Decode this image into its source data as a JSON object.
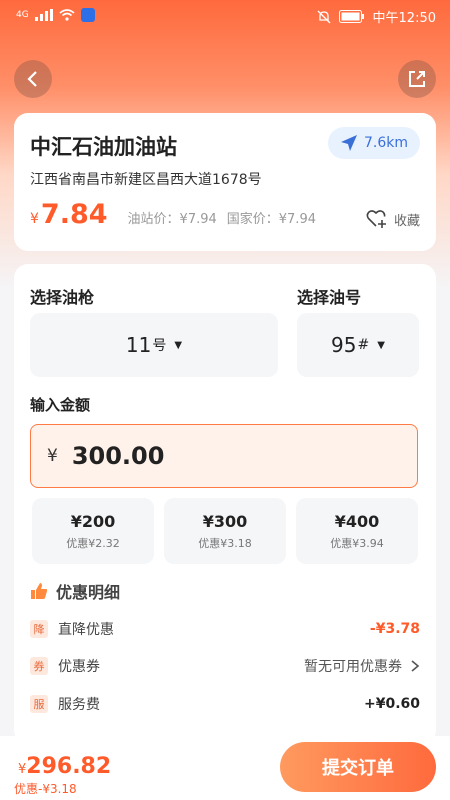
{
  "status": {
    "signal": "4G",
    "time": "中午12:50"
  },
  "station": {
    "name": "中汇石油加油站",
    "distance": "7.6km",
    "address": "江西省南昌市新建区昌西大道1678号",
    "price_symbol": "¥",
    "price": "7.84",
    "station_price": "油站价：¥7.94",
    "national_price": "国家价：¥7.94",
    "fav_label": "收藏"
  },
  "order": {
    "gun_label": "选择油枪",
    "gun_value": "11",
    "gun_unit": "号",
    "fuel_label": "选择油号",
    "fuel_value": "95",
    "fuel_unit": "#",
    "amount_label": "输入金额",
    "amount_symbol": "¥",
    "amount_value": "300.00",
    "quick_amounts": [
      {
        "amount": "¥200",
        "discount": "优惠¥2.32"
      },
      {
        "amount": "¥300",
        "discount": "优惠¥3.18"
      },
      {
        "amount": "¥400",
        "discount": "优惠¥3.94"
      }
    ],
    "discount_title": "优惠明细",
    "discount_rows": [
      {
        "badge": "降",
        "label": "直降优惠",
        "value": "-¥3.78",
        "color": "#ff5a2a"
      },
      {
        "badge": "券",
        "label": "优惠券",
        "value": "暂无可用优惠券",
        "color": "#555555"
      },
      {
        "badge": "服",
        "label": "服务费",
        "value": "+¥0.60",
        "color": "#222222"
      }
    ]
  },
  "footer": {
    "total_symbol": "¥",
    "total": "296.82",
    "total_discount": "优惠-¥3.18",
    "submit": "提交订单"
  },
  "colors": {
    "accent": "#ff5a2a",
    "blue": "#3b6fd8"
  }
}
